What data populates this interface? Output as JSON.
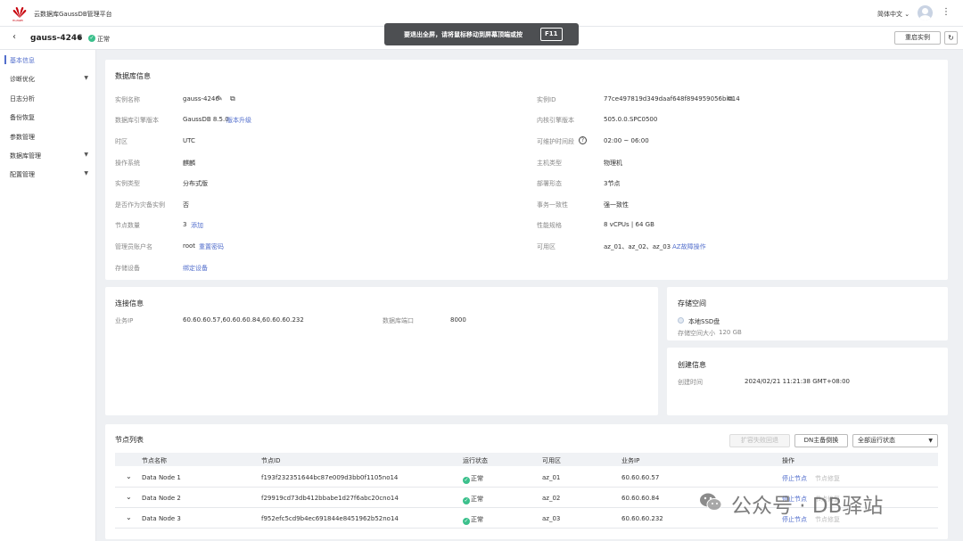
{
  "header": {
    "app_title": "云数据库GaussDB管理平台",
    "logo_text": "HUAWEI",
    "language": "简体中文 ⌄"
  },
  "subheader": {
    "instance_name": "gauss-4246",
    "status": "正常",
    "restart_label": "重启实例",
    "refresh_icon": "refresh-icon"
  },
  "toast": {
    "text": "要退出全屏，请将鼠标移动到屏幕顶端或按",
    "key": "F11"
  },
  "sidebar": {
    "items": [
      {
        "label": "基本信息",
        "active": true,
        "expandable": false
      },
      {
        "label": "诊断优化",
        "active": false,
        "expandable": true
      },
      {
        "label": "日志分析",
        "active": false,
        "expandable": false
      },
      {
        "label": "备份恢复",
        "active": false,
        "expandable": false
      },
      {
        "label": "参数管理",
        "active": false,
        "expandable": false
      },
      {
        "label": "数据库管理",
        "active": false,
        "expandable": true
      },
      {
        "label": "配置管理",
        "active": false,
        "expandable": true
      }
    ]
  },
  "db_info": {
    "title": "数据库信息",
    "instance_name_label": "实例名称",
    "instance_name": "gauss-4246",
    "engine_version_label": "数据库引擎版本",
    "engine_version": "GaussDB 8.5.0",
    "upgrade_link": "版本升级",
    "timezone_label": "时区",
    "timezone": "UTC",
    "os_label": "操作系统",
    "os": "麒麟",
    "instance_type_label": "实例类型",
    "instance_type": "分布式版",
    "dr_label": "是否作为灾备实例",
    "dr": "否",
    "node_count_label": "节点数量",
    "node_count": "3",
    "add_link": "添加",
    "admin_label": "管理员账户名",
    "admin": "root",
    "reset_pwd_link": "重置密码",
    "storage_label": "存储设备",
    "bind_link": "绑定设备",
    "instance_id_label": "实例ID",
    "instance_id": "77ce497819d349daaf648f894959056bin14",
    "kernel_version_label": "内核引擎版本",
    "kernel_version": "505.0.0.SPC0500",
    "maintenance_label": "可维护时间段",
    "maintenance": "02:00 ~ 06:00",
    "host_type_label": "主机类型",
    "host_type": "物理机",
    "deploy_label": "部署形态",
    "deploy": "3节点",
    "consistency_label": "事务一致性",
    "consistency": "强一致性",
    "spec_label": "性能规格",
    "spec": "8 vCPUs | 64 GB",
    "az_label": "可用区",
    "az": "az_01、az_02、az_03",
    "az_link": "AZ故障操作"
  },
  "connection": {
    "title": "连接信息",
    "ip_label": "业务IP",
    "ip": "60.60.60.57,60.60.60.84,60.60.60.232",
    "port_label": "数据库端口",
    "port": "8000"
  },
  "storage": {
    "title": "存储空间",
    "disk_type": "本地SSD盘",
    "size_label": "存储空间大小",
    "size": "120 GB"
  },
  "created": {
    "title": "创建信息",
    "time_label": "创建时间",
    "time": "2024/02/21 11:21:38 GMT+08:00"
  },
  "nodes": {
    "title": "节点列表",
    "scale_back_label": "扩容失败回退",
    "dn_switch_label": "DN主备倒换",
    "filter_value": "全部运行状态",
    "columns": [
      "节点名称",
      "节点ID",
      "运行状态",
      "可用区",
      "业务IP",
      "操作"
    ],
    "rows": [
      {
        "name": "Data Node 1",
        "id": "f193f232351644bc87e009d3bb0f1105no14",
        "status": "正常",
        "az": "az_01",
        "ip": "60.60.60.57",
        "action1": "停止节点",
        "action2": "节点修复"
      },
      {
        "name": "Data Node 2",
        "id": "f29919cd73db412bbabe1d27f6abc20cno14",
        "status": "正常",
        "az": "az_02",
        "ip": "60.60.60.84",
        "action1": "停止节点",
        "action2": "节点修复"
      },
      {
        "name": "Data Node 3",
        "id": "f952efc5cd9b4ec691844e8451962b52no14",
        "status": "正常",
        "az": "az_03",
        "ip": "60.60.60.232",
        "action1": "停止节点",
        "action2": "节点修复"
      }
    ]
  },
  "watermark": {
    "text": "公众号 · DB驿站"
  },
  "colors": {
    "accent": "#526ecc",
    "status_ok": "#3bc08c",
    "brand_red": "#c7000b"
  }
}
